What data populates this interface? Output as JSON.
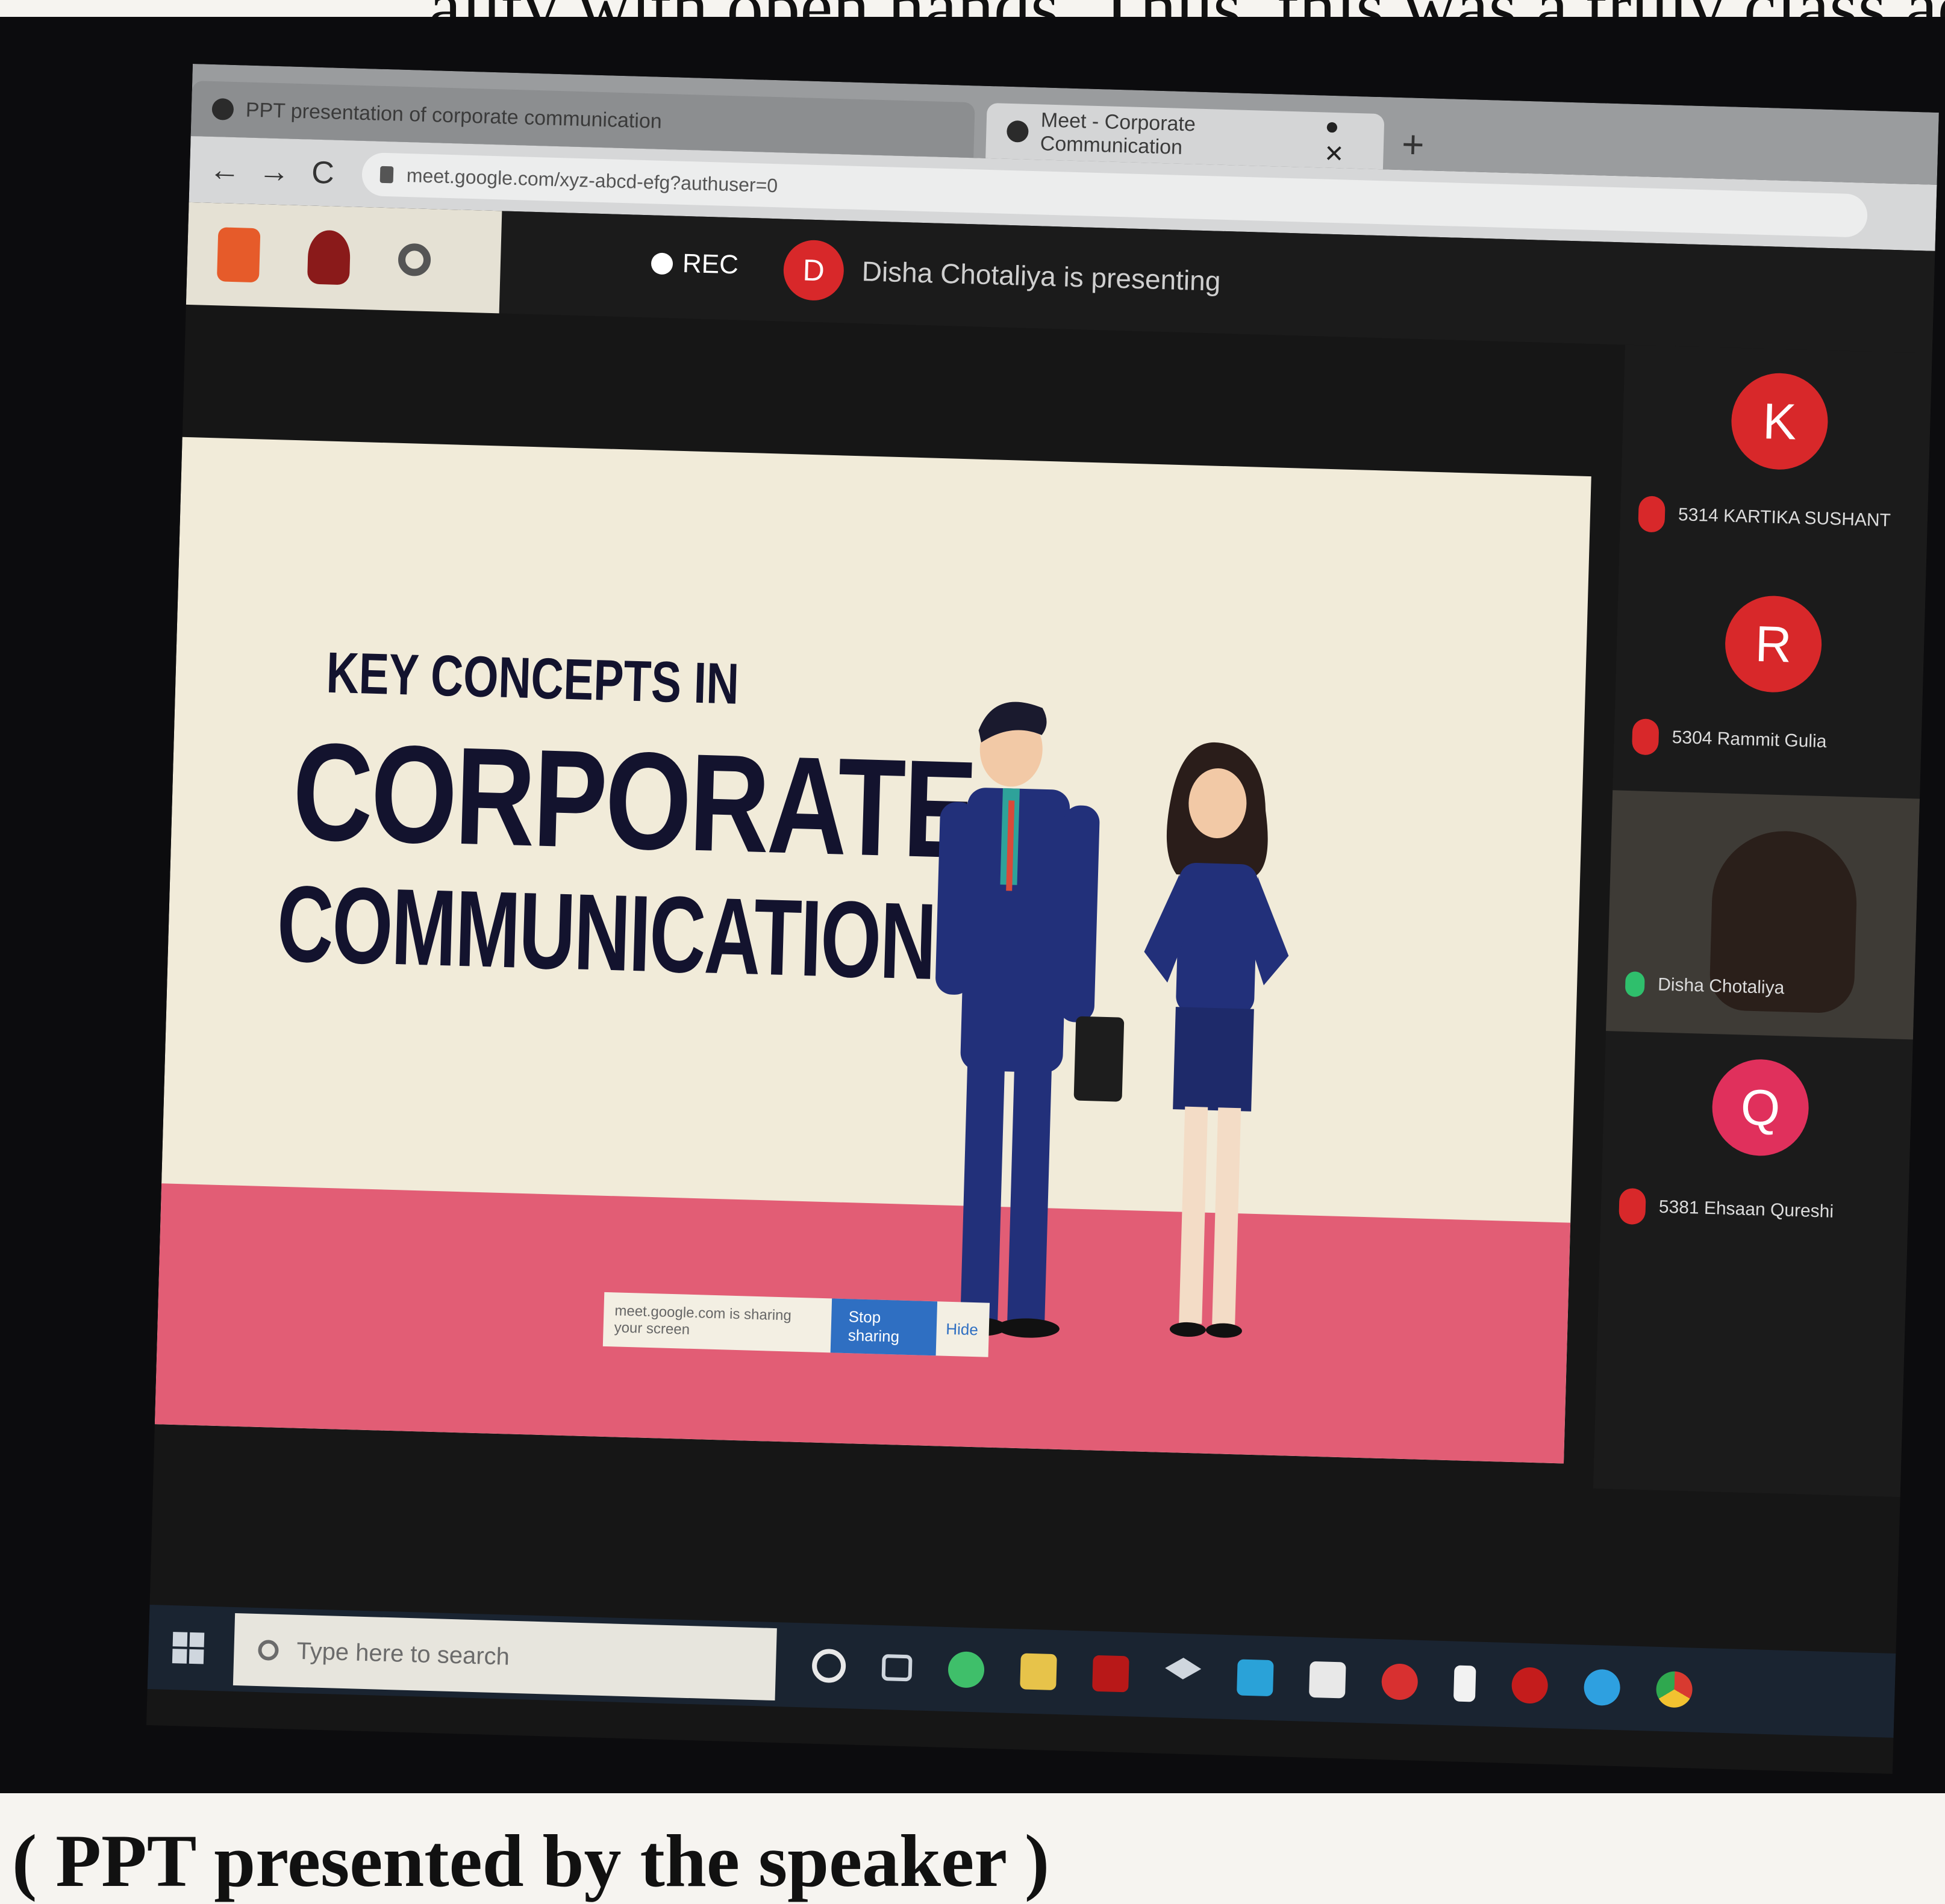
{
  "document": {
    "top_text": "...ality with open hands. Thus, this was a truly class act",
    "caption": "( PPT presented by the speaker )"
  },
  "browser": {
    "tabs": [
      {
        "label": "PPT presentation of corporate communication"
      },
      {
        "label": "Meet - Corporate Communication"
      }
    ],
    "new_tab": "+",
    "url": "meet.google.com/xyz-abcd-efg?authuser=0",
    "nav": {
      "back": "←",
      "forward": "→",
      "reload": "C"
    }
  },
  "meet": {
    "rec_label": "REC",
    "presenter_initial": "D",
    "presenting_text": "Disha Chotaliya is presenting",
    "participants": [
      {
        "initial": "K",
        "name": "5314 KARTIKA SUSHANT",
        "color": "#d8282a",
        "mic": "muted"
      },
      {
        "initial": "R",
        "name": "5304 Rammit Gulia",
        "color": "#d8282a",
        "mic": "muted"
      },
      {
        "initial": "",
        "name": "Disha Chotaliya",
        "color": "#3e3b36",
        "mic": "active",
        "video": true
      },
      {
        "initial": "Q",
        "name": "5381 Ehsaan Qureshi",
        "color": "#e0305c",
        "mic": "muted"
      }
    ]
  },
  "slide": {
    "line1": "KEY CONCEPTS IN",
    "line2": "CORPORATE",
    "line3": "COMMUNICATION",
    "share_notice": "meet.google.com is sharing your screen",
    "stop_sharing": "Stop sharing",
    "hide": "Hide"
  },
  "taskbar": {
    "search_placeholder": "Type here to search",
    "icons": [
      "start-icon",
      "cortana-icon",
      "task-view-icon",
      "edge-icon",
      "file-explorer-icon",
      "adobe-icon",
      "dropbox-icon",
      "mail-icon",
      "store-icon",
      "opera-icon",
      "notes-icon",
      "media-icon",
      "skype-icon",
      "chrome-icon"
    ]
  },
  "colors": {
    "slide_bg": "#f1ebd9",
    "slide_floor": "#e25d75",
    "title_navy": "#13132e",
    "avatar_red": "#d8282a",
    "taskbar": "#1a2431"
  }
}
